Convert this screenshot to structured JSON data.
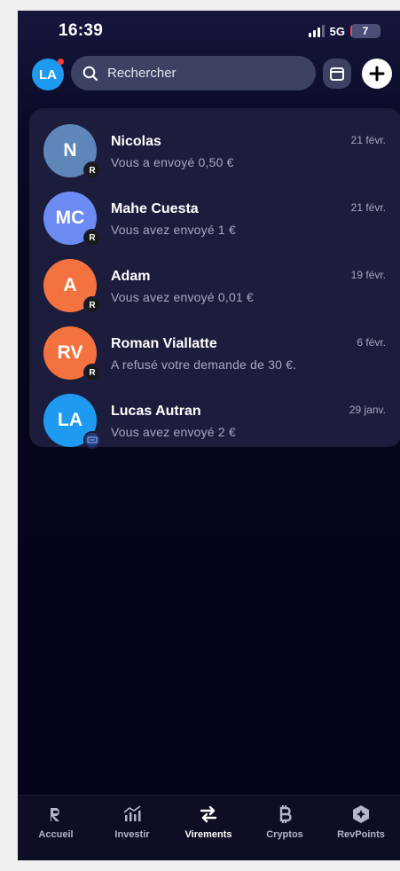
{
  "status_bar": {
    "time": "16:39",
    "network": "5G",
    "battery": "7",
    "battery_level": 0.07,
    "battery_color": "#ff3b5c"
  },
  "header": {
    "user_initials": "LA",
    "user_avatar_color": "#1e9bf0",
    "search": {
      "placeholder": "Rechercher",
      "icon": "search-icon"
    },
    "calendar_icon": "calendar-icon",
    "add_icon": "plus-icon"
  },
  "transfers": [
    {
      "initials": "N",
      "name": "Nicolas",
      "subtitle": "Vous a envoyé 0,50 €",
      "date": "21 févr.",
      "avatar_color": "#5f86b8",
      "badge": "R",
      "badge_icon": "revolut-badge-icon"
    },
    {
      "initials": "MC",
      "name": "Mahe Cuesta",
      "subtitle": "Vous avez envoyé 1 €",
      "date": "21 févr.",
      "avatar_color": "#6d8cf3",
      "badge": "R",
      "badge_icon": "revolut-badge-icon"
    },
    {
      "initials": "A",
      "name": "Adam",
      "subtitle": "Vous avez envoyé 0,01 €",
      "date": "19 févr.",
      "avatar_color": "#f4723f",
      "badge": "R",
      "badge_icon": "revolut-badge-icon"
    },
    {
      "initials": "RV",
      "name": "Roman Viallatte",
      "subtitle": "A refusé votre demande de 30 €.",
      "date": "6 févr.",
      "avatar_color": "#f4723f",
      "badge": "R",
      "badge_icon": "revolut-badge-icon"
    },
    {
      "initials": "LA",
      "name": "Lucas Autran",
      "subtitle": "Vous avez envoyé 2 €",
      "date": "29 janv.",
      "avatar_color": "#1e9bf0",
      "badge": "",
      "badge_icon": "bank-badge-icon"
    }
  ],
  "tabs": [
    {
      "label": "Accueil",
      "icon": "revolut-home-icon",
      "active": false
    },
    {
      "label": "Investir",
      "icon": "invest-icon",
      "active": false
    },
    {
      "label": "Virements",
      "icon": "transfer-icon",
      "active": true
    },
    {
      "label": "Cryptos",
      "icon": "bitcoin-icon",
      "active": false
    },
    {
      "label": "RevPoints",
      "icon": "revpoints-icon",
      "active": false
    }
  ]
}
